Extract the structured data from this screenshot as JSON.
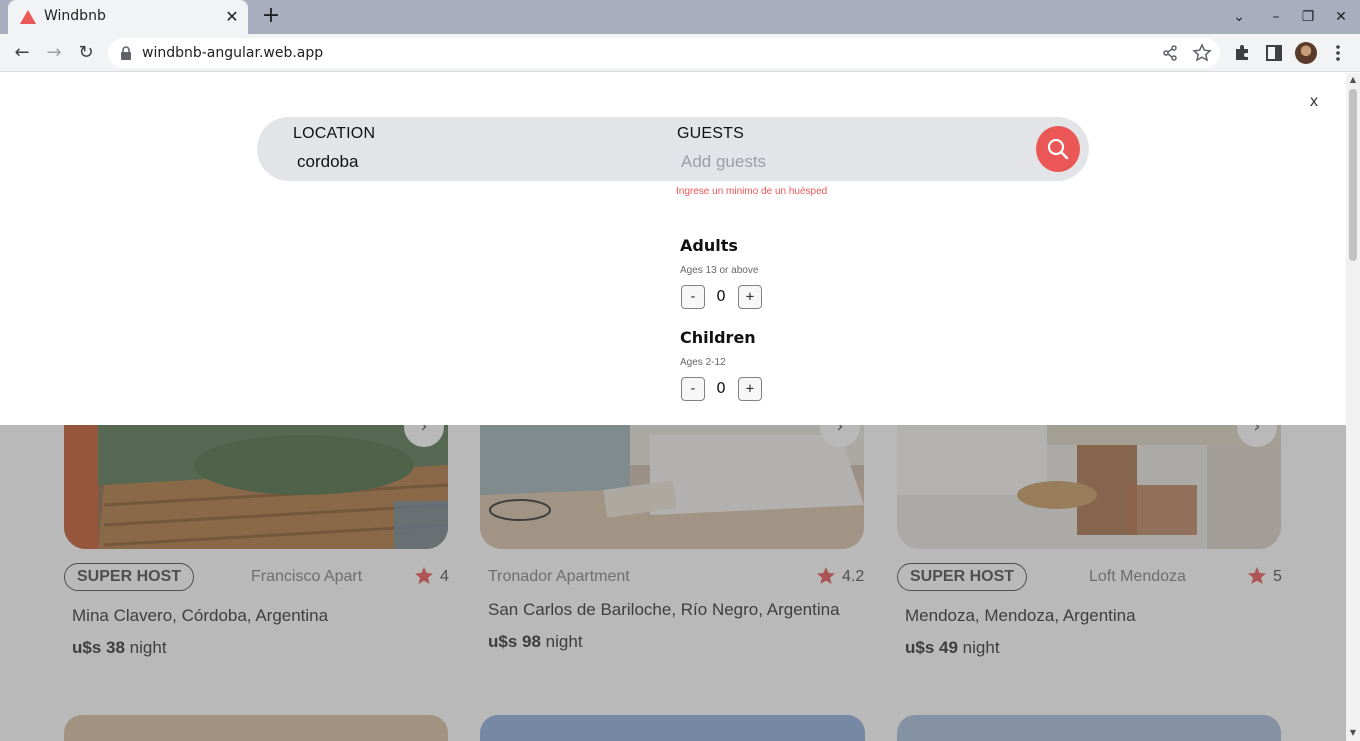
{
  "browser": {
    "tab_title": "Windbnb",
    "tab_close": "✕",
    "new_tab": "+",
    "url": "windbnb-angular.web.app",
    "controls": {
      "tab_search": "⌄",
      "minimize": "–",
      "restore": "❐",
      "close": "✕"
    },
    "nav": {
      "back": "←",
      "forward": "→",
      "reload": "↻"
    },
    "icons": {
      "share": "share-icon",
      "star": "bookmark-star-icon",
      "extensions": "puzzle-icon",
      "sidepanel": "side-panel-icon",
      "menu": "kebab-menu-icon"
    }
  },
  "search": {
    "close_label": "x",
    "location_label": "LOCATION",
    "location_value": "cordoba",
    "guests_label": "GUESTS",
    "guests_placeholder": "Add guests",
    "error": "Ingrese un minimo de un huésped",
    "accent_color": "#eb5757"
  },
  "guests": {
    "adults": {
      "title": "Adults",
      "subtitle": "Ages 13 or above",
      "minus": "-",
      "value": "0",
      "plus": "+"
    },
    "children": {
      "title": "Children",
      "subtitle": "Ages 2-12",
      "minus": "-",
      "value": "0",
      "plus": "+"
    }
  },
  "listings": [
    {
      "superhost": "SUPER HOST",
      "type": "Francisco Apart",
      "rating": "4",
      "location": "Mina Clavero, Córdoba, Argentina",
      "price": "u$s 38",
      "per": "night"
    },
    {
      "superhost": "",
      "type": "Tronador Apartment",
      "rating": "4.2",
      "location": "San Carlos de Bariloche, Río Negro, Argentina",
      "price": "u$s 98",
      "per": "night"
    },
    {
      "superhost": "SUPER HOST",
      "type": "Loft Mendoza",
      "rating": "5",
      "location": "Mendoza, Mendoza, Argentina",
      "price": "u$s 49",
      "per": "night"
    }
  ]
}
